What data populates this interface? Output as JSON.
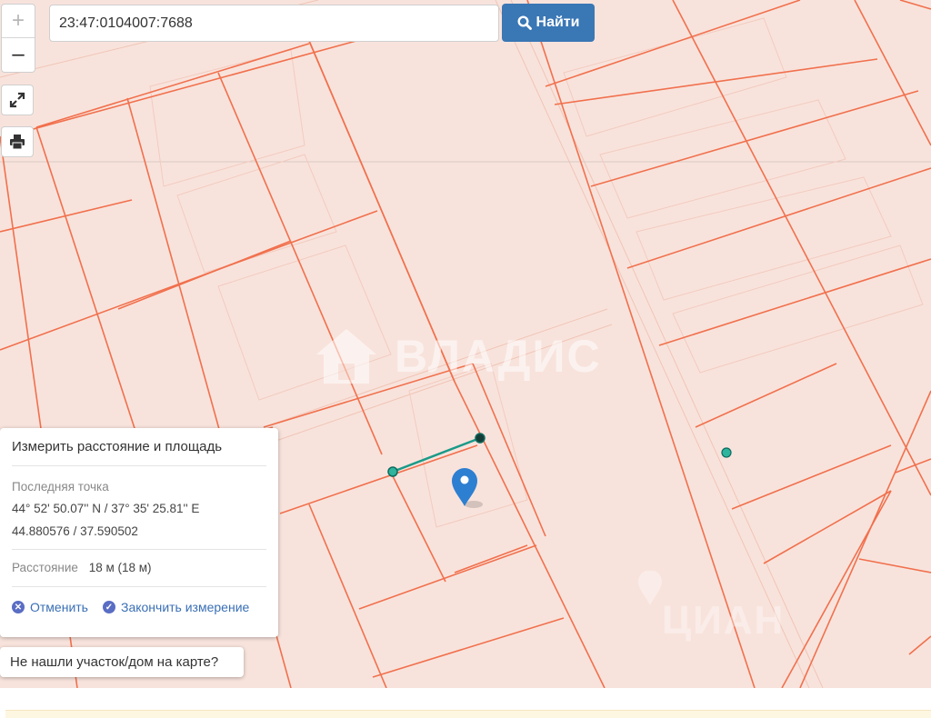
{
  "search": {
    "value": "23:47:0104007:7688",
    "button_label": "Найти"
  },
  "map": {
    "zoom_in_label": "+",
    "zoom_out_label": "–",
    "watermark_text": "ВЛАДИС",
    "watermark_secondary": "ЦИАН",
    "colors": {
      "background": "#f8e3dc",
      "parcel_border": "#f1704d",
      "road": "#f3d3c6",
      "measure_line": "#1a9a88",
      "marker": "#2d7fd1"
    }
  },
  "measure": {
    "title": "Измерить расстояние и площадь",
    "last_point_label": "Последняя точка",
    "coords_dms": "44° 52' 50.07'' N / 37° 35' 25.81'' E",
    "coords_decimal": "44.880576 / 37.590502",
    "distance_label": "Расстояние",
    "distance_value": "18 м (18 м)",
    "cancel_label": "Отменить",
    "finish_label": "Закончить измерение"
  },
  "not_found_label": "Не нашли участок/дом на карте?"
}
